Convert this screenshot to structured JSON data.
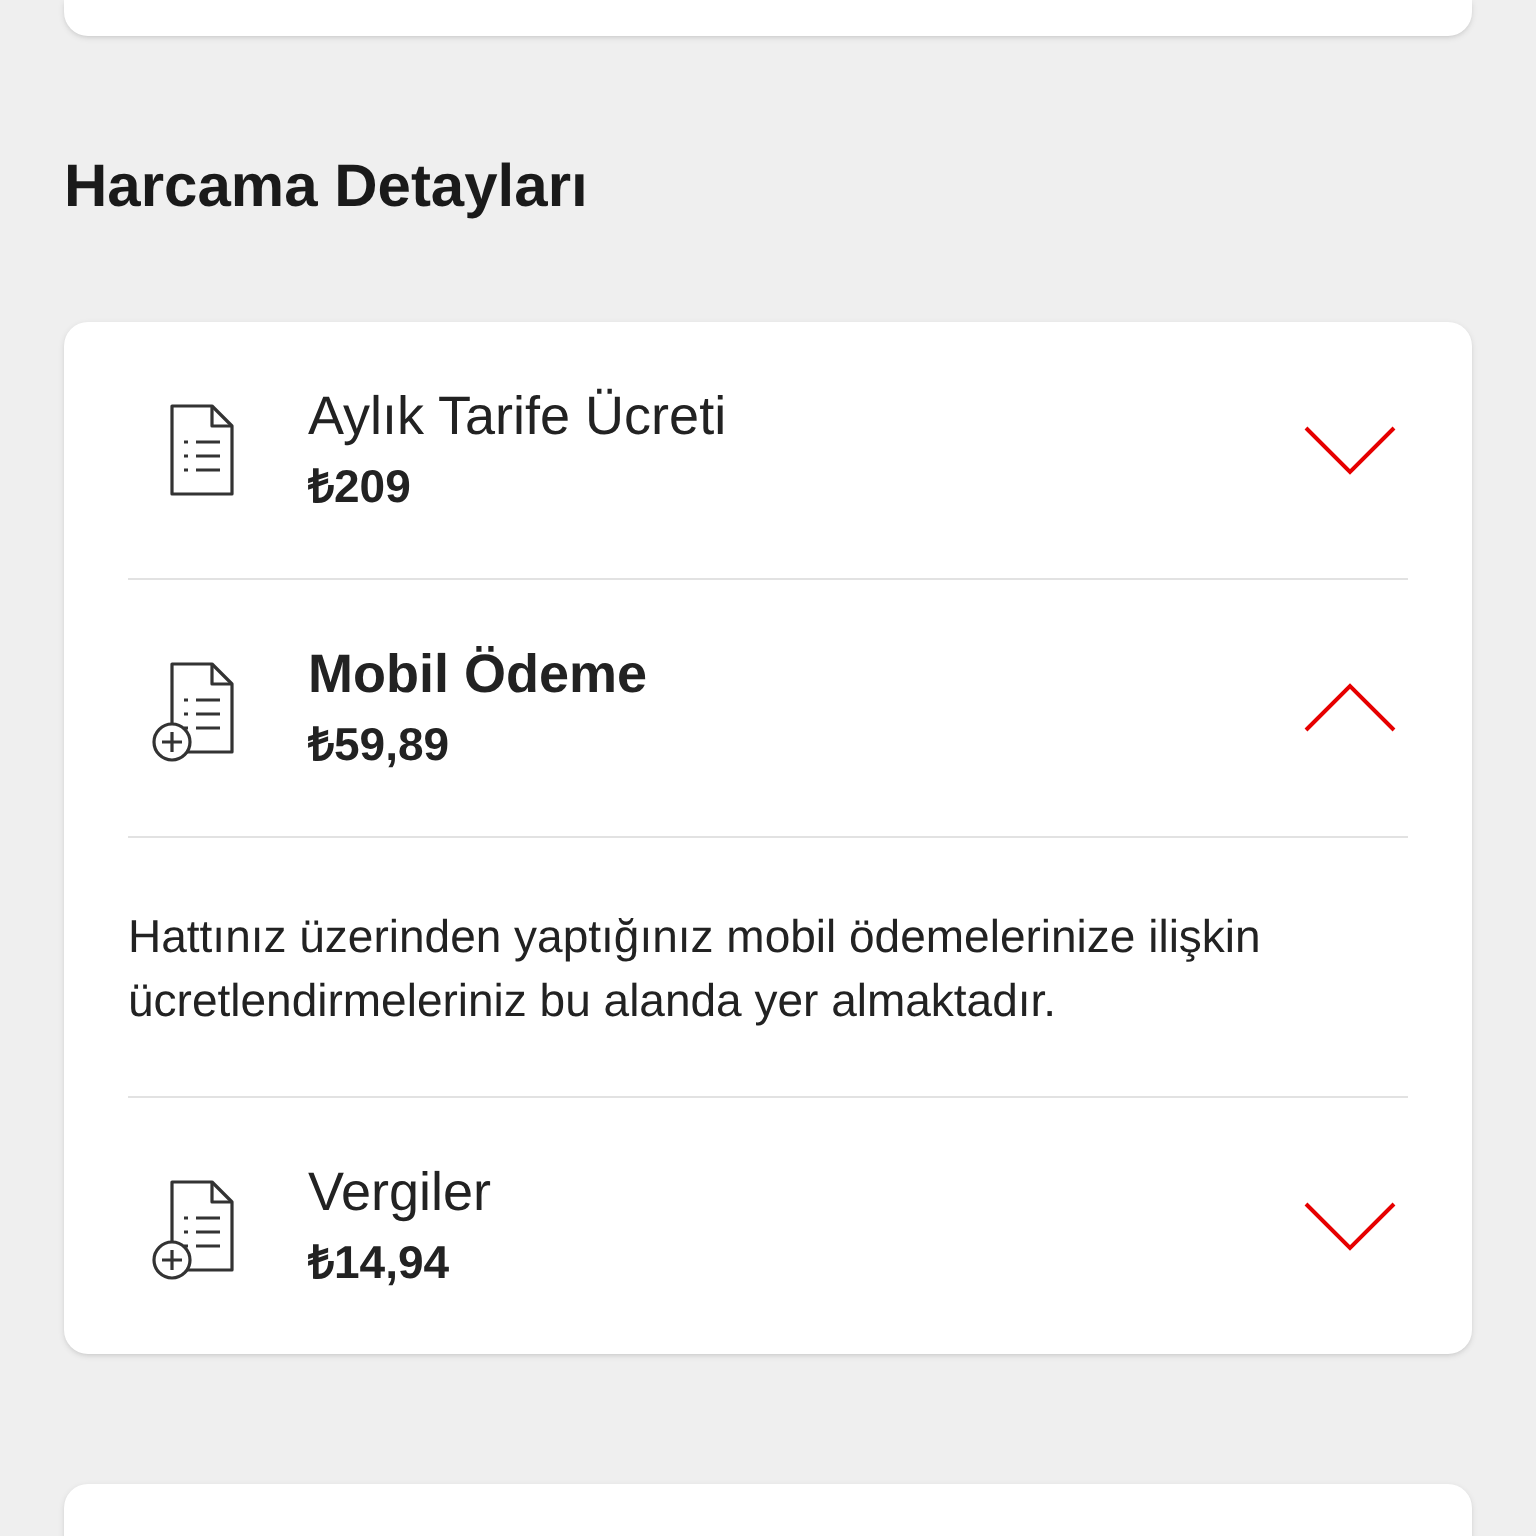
{
  "section_title": "Harcama Detayları",
  "items": [
    {
      "kind": "document",
      "title": "Aylık Tarife Ücreti",
      "amount": "₺209",
      "expanded": false
    },
    {
      "kind": "document-plus",
      "title": "Mobil Ödeme",
      "amount": "₺59,89",
      "expanded": true,
      "description": "Hattınız üzerinden yaptığınız mobil ödemelerinize ilişkin ücretlendirmeleriniz bu alanda yer almaktadır."
    },
    {
      "kind": "document-plus",
      "title": "Vergiler",
      "amount": "₺14,94",
      "expanded": false
    }
  ]
}
